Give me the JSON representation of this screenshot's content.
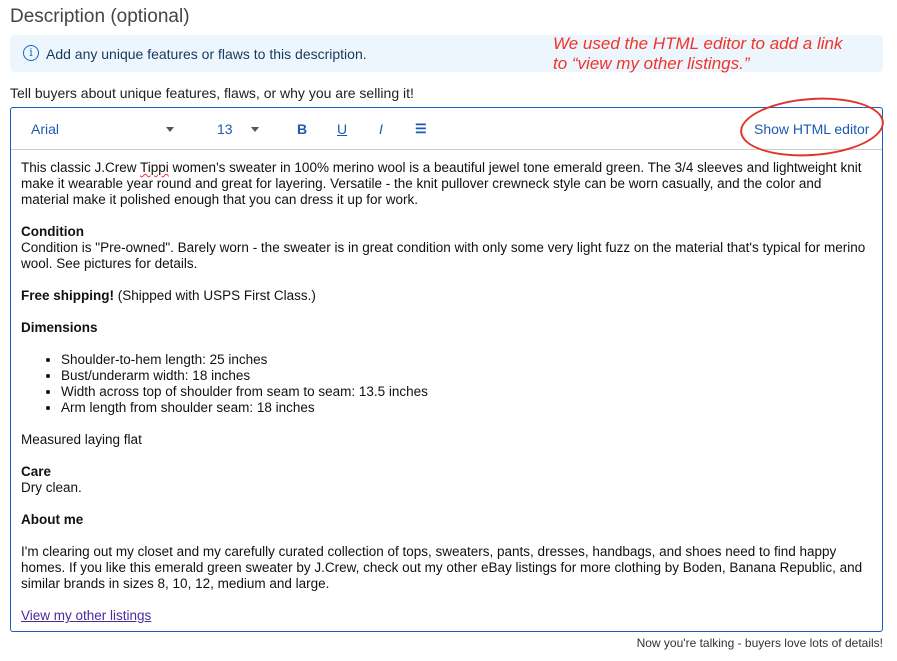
{
  "title": "Description (optional)",
  "info": "Add any unique features or flaws to this description.",
  "annotation": "We used the HTML editor to add a link to “view my other listings.”",
  "hint": "Tell buyers about unique features, flaws, or why you are selling it!",
  "toolbar": {
    "font": "Arial",
    "size": "13",
    "bold": "B",
    "underline": "U",
    "italic": "I",
    "html_editor": "Show HTML editor"
  },
  "content": {
    "intro_a": "This classic J.Crew ",
    "intro_spell": "Tippi",
    "intro_b": " women's sweater in 100% merino wool is a beautiful jewel tone emerald green. The 3/4 sleeves and lightweight knit make it wearable year round and great for layering. Versatile - the knit pullover crewneck style can be worn casually, and the color and material make it polished enough that you can dress it up for work.",
    "condition_h": "Condition",
    "condition": "Condition is \"Pre-owned\". Barely worn - the sweater is in great condition with only some very light fuzz on the material that's typical for merino wool. See pictures for details.",
    "shipping_b": "Free shipping!",
    "shipping": " (Shipped with USPS First Class.)",
    "dimensions_h": "Dimensions",
    "dimensions": [
      "Shoulder-to-hem length: 25 inches",
      "Bust/underarm width: 18 inches",
      "Width across top of shoulder from seam to seam: 13.5 inches",
      "Arm length from shoulder seam: 18 inches"
    ],
    "measured": "Measured laying flat",
    "care_h": "Care",
    "care": "Dry clean.",
    "about_h": "About me",
    "about": "I'm clearing out my closet and my carefully curated collection of tops, sweaters, pants, dresses, handbags, and shoes need to find happy homes. If you like this emerald green sweater by J.Crew, check out my other eBay listings for more clothing by Boden, Banana Republic, and similar brands in sizes 8, 10, 12, medium and large.",
    "link": "View my other listings"
  },
  "footer": "Now you're talking - buyers love lots of details!"
}
